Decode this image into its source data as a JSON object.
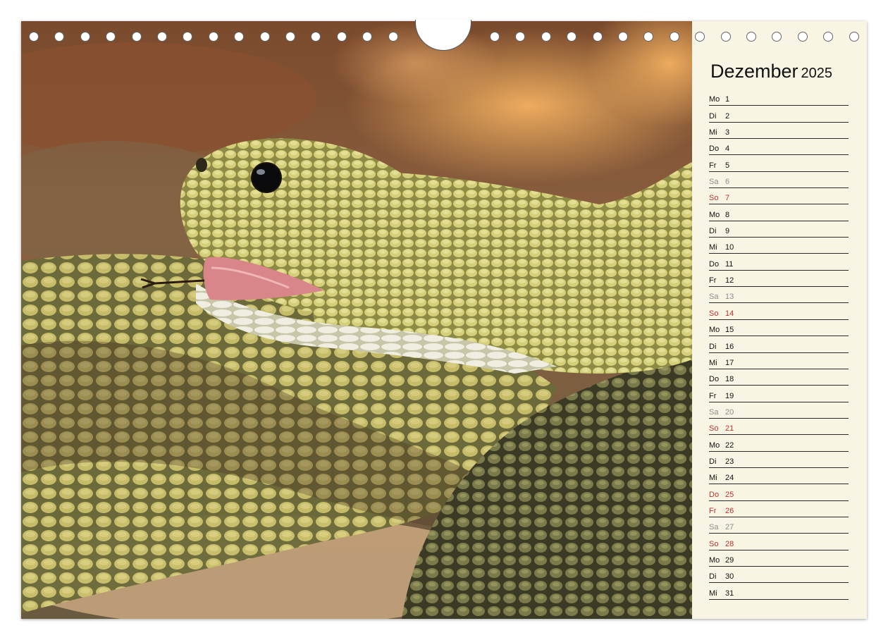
{
  "calendar": {
    "month": "Dezember",
    "year": "2025",
    "days": [
      {
        "wd": "Mo",
        "d": "1",
        "type": "weekday"
      },
      {
        "wd": "Di",
        "d": "2",
        "type": "weekday"
      },
      {
        "wd": "Mi",
        "d": "3",
        "type": "weekday"
      },
      {
        "wd": "Do",
        "d": "4",
        "type": "weekday"
      },
      {
        "wd": "Fr",
        "d": "5",
        "type": "weekday"
      },
      {
        "wd": "Sa",
        "d": "6",
        "type": "sat"
      },
      {
        "wd": "So",
        "d": "7",
        "type": "sun"
      },
      {
        "wd": "Mo",
        "d": "8",
        "type": "weekday"
      },
      {
        "wd": "Di",
        "d": "9",
        "type": "weekday"
      },
      {
        "wd": "Mi",
        "d": "10",
        "type": "weekday"
      },
      {
        "wd": "Do",
        "d": "11",
        "type": "weekday"
      },
      {
        "wd": "Fr",
        "d": "12",
        "type": "weekday"
      },
      {
        "wd": "Sa",
        "d": "13",
        "type": "sat"
      },
      {
        "wd": "So",
        "d": "14",
        "type": "sun"
      },
      {
        "wd": "Mo",
        "d": "15",
        "type": "weekday"
      },
      {
        "wd": "Di",
        "d": "16",
        "type": "weekday"
      },
      {
        "wd": "Mi",
        "d": "17",
        "type": "weekday"
      },
      {
        "wd": "Do",
        "d": "18",
        "type": "weekday"
      },
      {
        "wd": "Fr",
        "d": "19",
        "type": "weekday"
      },
      {
        "wd": "Sa",
        "d": "20",
        "type": "sat"
      },
      {
        "wd": "So",
        "d": "21",
        "type": "sun"
      },
      {
        "wd": "Mo",
        "d": "22",
        "type": "weekday"
      },
      {
        "wd": "Di",
        "d": "23",
        "type": "weekday"
      },
      {
        "wd": "Mi",
        "d": "24",
        "type": "weekday"
      },
      {
        "wd": "Do",
        "d": "25",
        "type": "holiday"
      },
      {
        "wd": "Fr",
        "d": "26",
        "type": "holiday"
      },
      {
        "wd": "Sa",
        "d": "27",
        "type": "sat"
      },
      {
        "wd": "So",
        "d": "28",
        "type": "sun"
      },
      {
        "wd": "Mo",
        "d": "29",
        "type": "weekday"
      },
      {
        "wd": "Di",
        "d": "30",
        "type": "weekday"
      },
      {
        "wd": "Mi",
        "d": "31",
        "type": "weekday"
      }
    ]
  },
  "photo": {
    "subject": "rattlesnake-head"
  },
  "colors": {
    "sunday": "#c0302c",
    "saturday": "#8d8d8d",
    "sidebar": "#f8f5e4"
  }
}
